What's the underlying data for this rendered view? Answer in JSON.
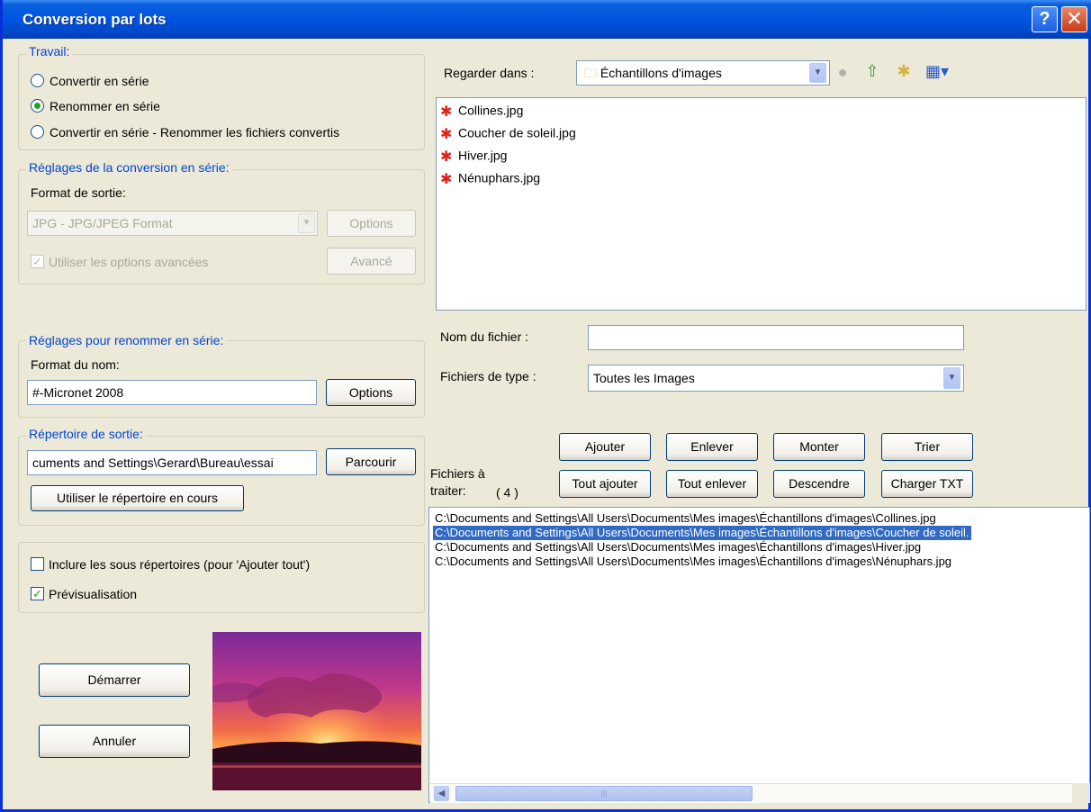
{
  "window": {
    "title": "Conversion par lots",
    "help": "?",
    "close": "✕"
  },
  "job": {
    "legend": "Travail:",
    "options": [
      {
        "label": "Convertir en série",
        "selected": false
      },
      {
        "label": "Renommer en série",
        "selected": true
      },
      {
        "label": "Convertir en série - Renommer les fichiers convertis",
        "selected": false
      }
    ]
  },
  "convert_settings": {
    "legend": "Réglages de la conversion en série:",
    "format_label": "Format de sortie:",
    "format_value": "JPG - JPG/JPEG Format",
    "options_button": "Options",
    "advanced_checkbox": "Utiliser les options avancées",
    "advanced_button": "Avancé"
  },
  "rename_settings": {
    "legend": "Réglages pour renommer en série:",
    "name_format_label": "Format du nom:",
    "name_format_value": "#-Micronet 2008",
    "options_button": "Options"
  },
  "output_dir": {
    "legend": "Répertoire de sortie:",
    "path": "cuments and Settings\\Gerard\\Bureau\\essai",
    "browse_button": "Parcourir",
    "use_current_button": "Utiliser le répertoire en cours"
  },
  "checks": {
    "include_subdirs": "Inclure les sous répertoires (pour 'Ajouter tout')",
    "preview": "Prévisualisation"
  },
  "actions": {
    "start": "Démarrer",
    "cancel": "Annuler"
  },
  "browser": {
    "look_in_label": "Regarder dans :",
    "look_in_value": "Échantillons d'images",
    "files": [
      "Collines.jpg",
      "Coucher de soleil.jpg",
      "Hiver.jpg",
      "Nénuphars.jpg"
    ],
    "filename_label": "Nom du fichier :",
    "filename_value": "",
    "filetype_label": "Fichiers de type :",
    "filetype_value": "Toutes les Images"
  },
  "queue_buttons": {
    "add": "Ajouter",
    "remove": "Enlever",
    "up": "Monter",
    "sort": "Trier",
    "add_all": "Tout ajouter",
    "remove_all": "Tout enlever",
    "down": "Descendre",
    "load_txt": "Charger TXT"
  },
  "queue": {
    "label_line1": "Fichiers à",
    "label_line2": "traiter:",
    "count": "( 4 )",
    "items": [
      "C:\\Documents and Settings\\All Users\\Documents\\Mes images\\Échantillons d'images\\Collines.jpg",
      "C:\\Documents and Settings\\All Users\\Documents\\Mes images\\Échantillons d'images\\Coucher de soleil.",
      "C:\\Documents and Settings\\All Users\\Documents\\Mes images\\Échantillons d'images\\Hiver.jpg",
      "C:\\Documents and Settings\\All Users\\Documents\\Mes images\\Échantillons d'images\\Nénuphars.jpg"
    ],
    "selected_index": 1
  },
  "colors": {
    "title_bar": "#0054e3",
    "selection": "#316ac5",
    "legend_text": "#0046d5",
    "dialog_bg": "#ece9d8"
  },
  "icons": [
    "question-icon",
    "close-icon",
    "folder-icon",
    "back-icon",
    "up-folder-icon",
    "new-folder-icon",
    "view-menu-icon",
    "image-file-icon",
    "scroll-left-icon",
    "scroll-right-icon"
  ]
}
